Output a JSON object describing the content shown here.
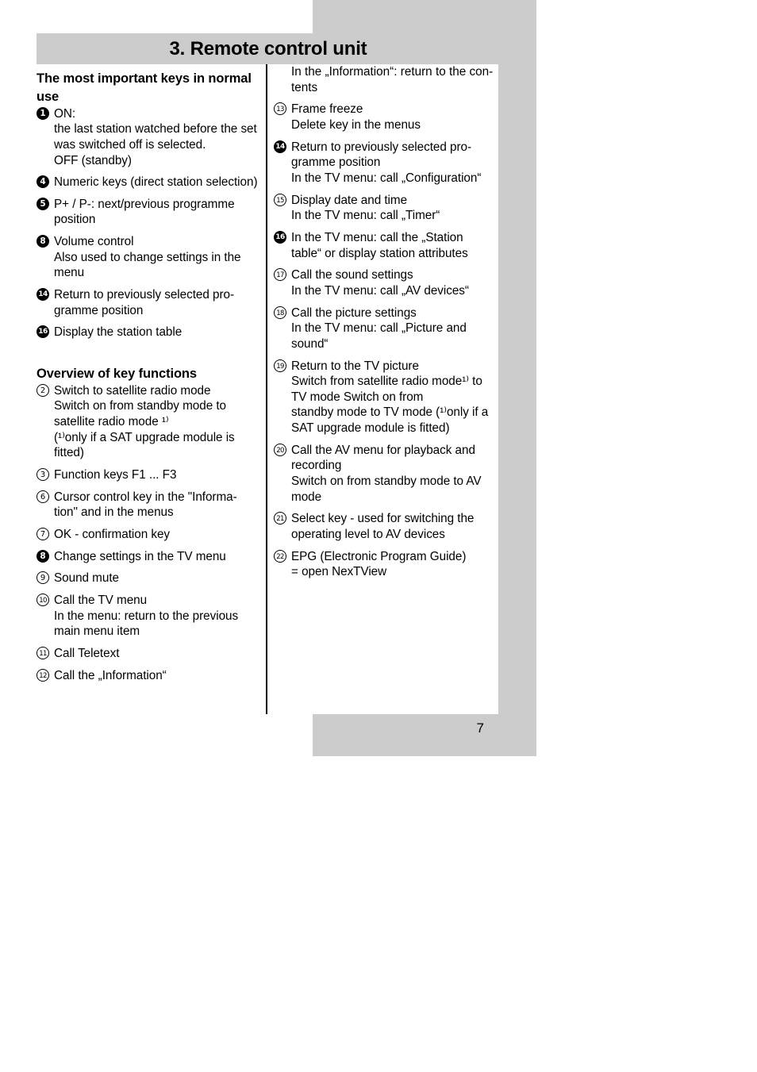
{
  "header": {
    "title": "3. Remote control unit"
  },
  "page_number": "7",
  "colors": {
    "band_gray": "#cccccc",
    "text": "#000000",
    "background": "#ffffff"
  },
  "left_column": {
    "section1_title": "The most important keys in normal use",
    "section1_items": [
      {
        "marker": "1",
        "style": "filled",
        "lines": [
          "ON:",
          "the last station watched before the set",
          "was switched off is selected.",
          "OFF (standby)"
        ]
      },
      {
        "marker": "4",
        "style": "filled",
        "lines": [
          "Numeric keys (direct station selection)"
        ]
      },
      {
        "marker": "5",
        "style": "filled",
        "lines": [
          "P+ / P-: next/previous programme",
          "position"
        ]
      },
      {
        "marker": "8",
        "style": "filled",
        "lines": [
          "Volume control",
          "Also used to change settings in the",
          "menu"
        ]
      },
      {
        "marker": "14",
        "style": "filled",
        "lines": [
          "Return to previously selected pro-",
          "gramme position"
        ]
      },
      {
        "marker": "16",
        "style": "filled",
        "lines": [
          "Display the station table"
        ]
      }
    ],
    "section2_title": "Overview of key functions",
    "section2_items": [
      {
        "marker": "2",
        "style": "outline",
        "lines": [
          "Switch to satellite radio mode",
          "Switch on from standby mode to",
          "satellite radio mode ¹⁾",
          "(¹⁾only if a SAT upgrade module is",
          "fitted)"
        ]
      },
      {
        "marker": "3",
        "style": "outline",
        "lines": [
          "Function keys F1 ... F3"
        ]
      },
      {
        "marker": "6",
        "style": "outline",
        "lines": [
          "Cursor control key in the \"Informa-",
          "tion\" and in the menus"
        ]
      },
      {
        "marker": "7",
        "style": "outline",
        "lines": [
          "OK - confirmation key"
        ]
      },
      {
        "marker": "8",
        "style": "filled",
        "lines": [
          "Change settings in the TV menu"
        ]
      },
      {
        "marker": "9",
        "style": "outline",
        "lines": [
          "Sound mute"
        ]
      },
      {
        "marker": "10",
        "style": "outline",
        "lines": [
          "Call the TV menu",
          "In the menu: return to the previous",
          "main menu item"
        ]
      },
      {
        "marker": "11",
        "style": "outline",
        "lines": [
          "Call Teletext"
        ]
      },
      {
        "marker": "12",
        "style": "outline",
        "lines": [
          "Call the „Information“"
        ]
      }
    ]
  },
  "right_column": {
    "continuation_lines": [
      "In the „Information“: return to the con-",
      "tents"
    ],
    "items": [
      {
        "marker": "13",
        "style": "outline",
        "lines": [
          "Frame freeze",
          "Delete key in the menus"
        ]
      },
      {
        "marker": "14",
        "style": "filled",
        "lines": [
          "Return to previously selected pro-",
          "gramme position",
          "In the TV menu: call „Configuration“"
        ]
      },
      {
        "marker": "15",
        "style": "outline",
        "lines": [
          "Display date and time",
          "In the TV menu: call „Timer“"
        ]
      },
      {
        "marker": "16",
        "style": "filled",
        "lines": [
          "In the TV menu: call the „Station",
          "table“ or display station attributes"
        ]
      },
      {
        "marker": "17",
        "style": "outline",
        "lines": [
          "Call the sound settings",
          "In the TV menu: call „AV devices“"
        ]
      },
      {
        "marker": "18",
        "style": "outline",
        "lines": [
          "Call the picture settings",
          "In the TV menu: call „Picture and",
          "sound“"
        ]
      },
      {
        "marker": "19",
        "style": "outline",
        "lines": [
          "Return to the TV picture",
          "Switch from satellite radio mode¹⁾ to",
          "TV mode Switch on from",
          "standby mode to TV mode  (¹⁾only if a",
          "SAT upgrade module is fitted)"
        ]
      },
      {
        "marker": "20",
        "style": "outline",
        "lines": [
          "Call the AV menu for playback and",
          "recording",
          "Switch on from standby mode to AV",
          "mode"
        ]
      },
      {
        "marker": "21",
        "style": "outline",
        "lines": [
          "Select key - used for switching the",
          "operating level to AV devices"
        ]
      },
      {
        "marker": "22",
        "style": "outline",
        "lines": [
          "EPG (Electronic Program Guide)",
          "= open NexTView"
        ]
      }
    ]
  }
}
